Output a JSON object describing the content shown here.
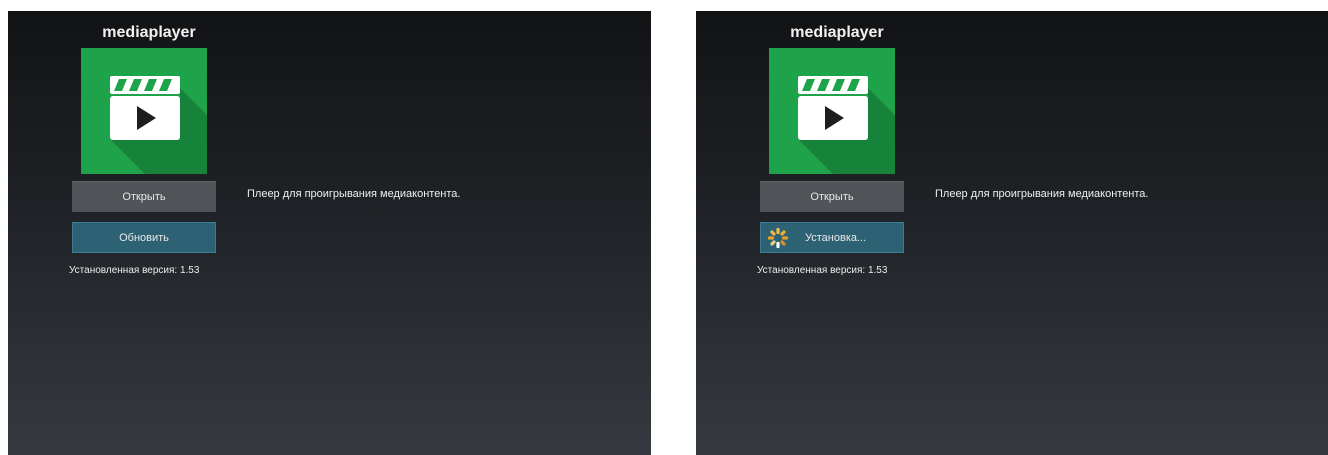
{
  "left": {
    "app_title": "mediaplayer",
    "open_label": "Открыть",
    "update_label": "Обновить",
    "version_text": "Установленная версия: 1.53",
    "description": "Плеер для проигрывания медиаконтента."
  },
  "right": {
    "app_title": "mediaplayer",
    "open_label": "Открыть",
    "installing_label": "Установка...",
    "version_text": "Установленная версия: 1.53",
    "description": "Плеер для проигрывания медиаконтента."
  },
  "colors": {
    "icon_background": "#1ea34a",
    "update_button": "#2d6275",
    "open_button": "#505358",
    "spinner": "#f0a020"
  },
  "icons": [
    "clapperboard-icon",
    "play-icon",
    "spinner-icon"
  ]
}
